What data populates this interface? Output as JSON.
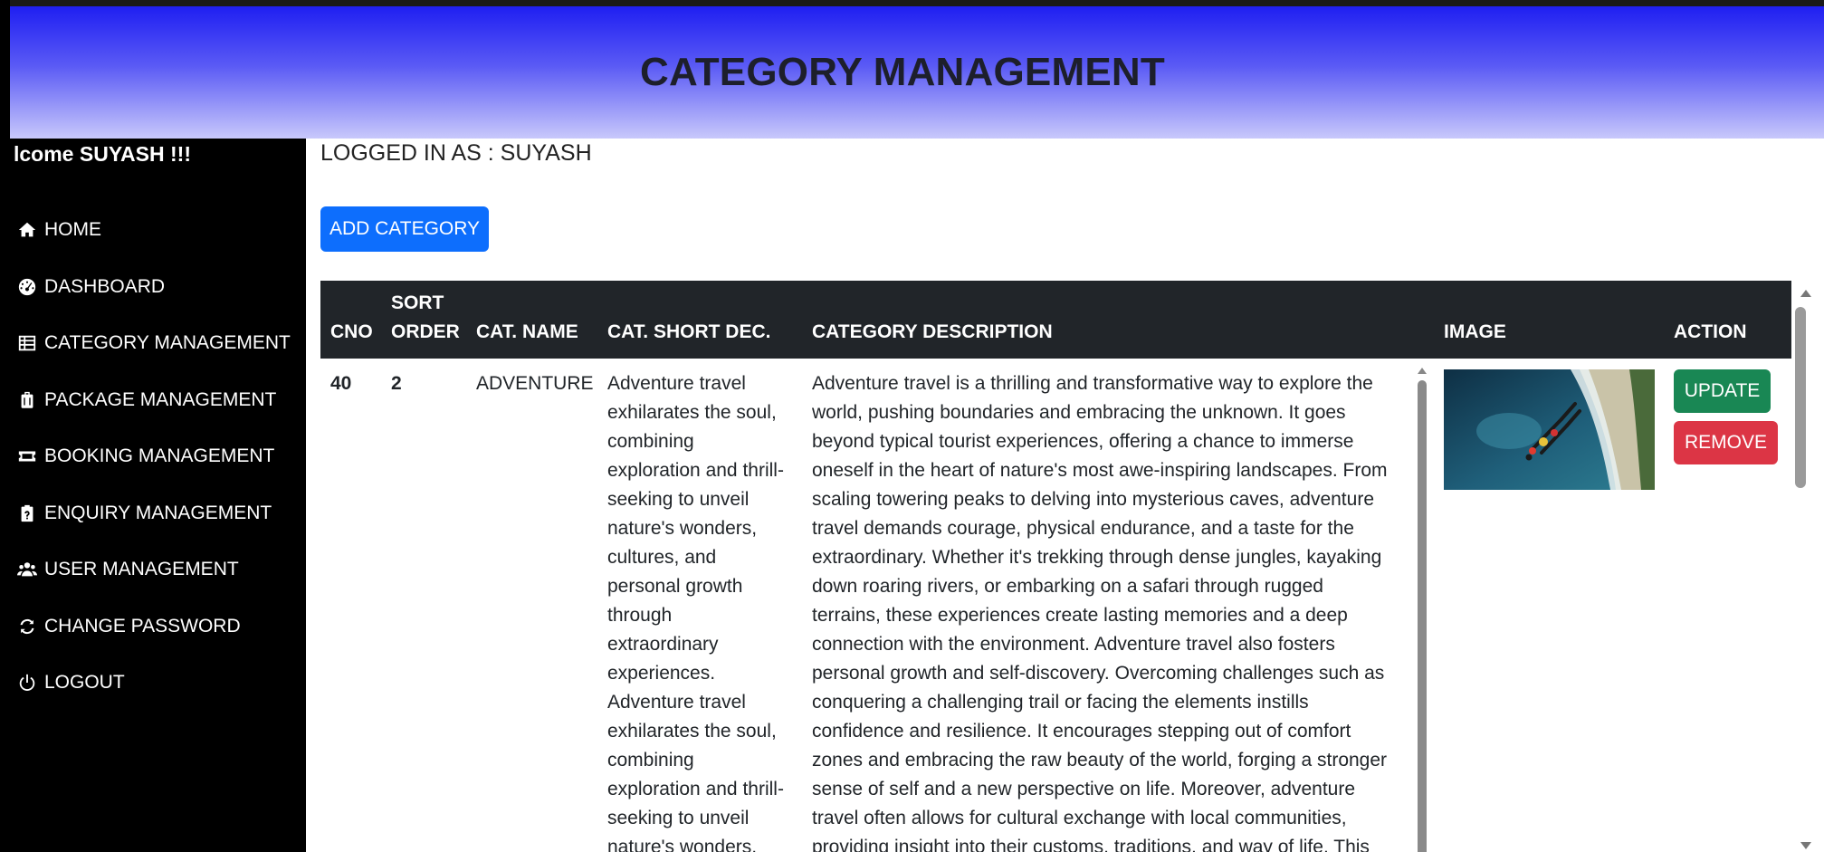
{
  "header": {
    "title": "CATEGORY MANAGEMENT"
  },
  "sidebar": {
    "welcome": "lcome SUYASH !!!",
    "items": [
      {
        "label": "HOME",
        "icon": "home-icon"
      },
      {
        "label": "DASHBOARD",
        "icon": "gauge-icon"
      },
      {
        "label": "CATEGORY MANAGEMENT",
        "icon": "table-list-icon"
      },
      {
        "label": "PACKAGE MANAGEMENT",
        "icon": "suitcase-icon"
      },
      {
        "label": "BOOKING MANAGEMENT",
        "icon": "ticket-icon"
      },
      {
        "label": "ENQUIRY MANAGEMENT",
        "icon": "clipboard-question-icon"
      },
      {
        "label": "USER MANAGEMENT",
        "icon": "users-icon"
      },
      {
        "label": "CHANGE PASSWORD",
        "icon": "refresh-icon"
      },
      {
        "label": "LOGOUT",
        "icon": "power-icon"
      }
    ]
  },
  "main": {
    "logged_in": "LOGGED IN AS : SUYASH",
    "add_button": "ADD CATEGORY",
    "table": {
      "headers": {
        "cno": "CNO",
        "sort_line1": "SORT",
        "sort_line2": "ORDER",
        "name": "CAT. NAME",
        "short": "CAT. SHORT DEC.",
        "desc": "CATEGORY DESCRIPTION",
        "image": "IMAGE",
        "action": "ACTION"
      },
      "rows": [
        {
          "cno": "40",
          "sort_order": "2",
          "name": "ADVENTURE",
          "short_lines": [
            "Adventure travel",
            "exhilarates the soul,",
            "combining",
            "exploration and thrill-",
            "seeking to unveil",
            "nature's wonders,",
            "cultures, and",
            "personal growth",
            "through",
            "extraordinary",
            "experiences.",
            "Adventure travel",
            "exhilarates the soul,",
            "combining",
            "exploration and thrill-",
            "seeking to unveil",
            "nature's wonders,"
          ],
          "desc_lines": [
            "Adventure travel is a thrilling and transformative way to explore the",
            "world, pushing boundaries and embracing the unknown. It goes",
            "beyond typical tourist experiences, offering a chance to immerse",
            "oneself in the heart of nature's most awe-inspiring landscapes. From",
            "scaling towering peaks to delving into mysterious caves, adventure",
            "travel demands courage, physical endurance, and a taste for the",
            "extraordinary. Whether it's trekking through dense jungles, kayaking",
            "down roaring rivers, or embarking on a safari through rugged",
            "terrains, these experiences create lasting memories and a deep",
            "connection with the environment. Adventure travel also fosters",
            "personal growth and self-discovery. Overcoming challenges such as",
            "conquering a challenging trail or facing the elements instills",
            "confidence and resilience. It encourages stepping out of comfort",
            "zones and embracing the raw beauty of the world, forging a stronger",
            "sense of self and a new perspective on life. Moreover, adventure",
            "travel often allows for cultural exchange with local communities,",
            "providing insight into their customs, traditions, and way of life. This"
          ],
          "update_label": "UPDATE",
          "remove_label": "REMOVE"
        }
      ]
    }
  },
  "colors": {
    "primary": "#0d6efd",
    "success": "#198754",
    "danger": "#dc3545",
    "table_header": "#212529",
    "sidebar_bg": "#000000"
  }
}
